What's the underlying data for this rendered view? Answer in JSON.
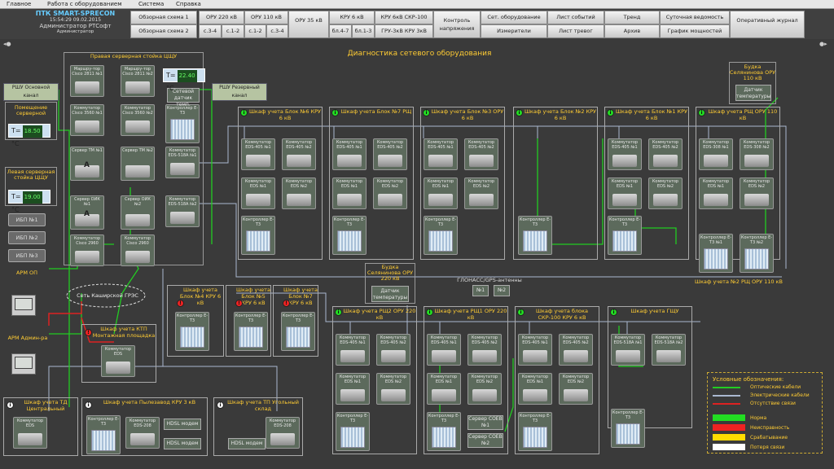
{
  "menu": [
    "Главное",
    "Работа с оборудованием",
    "Система",
    "Справка"
  ],
  "header": {
    "brand": "ПТК SMART-SPRECON",
    "datetime": "15:54:29 09.02.2015",
    "user": "Администратор РТСофт",
    "role": "Администратор"
  },
  "nav": {
    "overview1": "Обзорная схема 1",
    "overview2": "Обзорная схема 2",
    "oru220": "ОРУ 220 кВ",
    "c34a": "с.3-4",
    "c12a": "с.1-2",
    "oru110": "ОРУ 110 кВ",
    "c12b": "с.1-2",
    "c34b": "с.3-4",
    "oru35": "ОРУ 35 кВ",
    "kru6": "КРУ 6 кВ",
    "bl47": "бл.4-7",
    "bl13": "бл.1-3",
    "kru6skr": "КРУ 6кВ СКР-100",
    "gru": "ГРУ-3кВ КРУ 3кВ",
    "control": "Контроль напряжения",
    "net": "Сет. оборудование",
    "meters": "Измерители",
    "events": "Лист событий",
    "alarms": "Лист тревог",
    "trend": "Тренд",
    "archive": "Архив",
    "daily": "Суточная ведомость",
    "power": "График мощностей",
    "journal": "Оперативный журнал"
  },
  "page_title": "Диагностика сетевого оборудования",
  "left": {
    "rack_right": "Правая серверная стойка ЦЩУ",
    "rack_left": "Левая серверная стойка ЦЩУ",
    "room": "Помещение серверной",
    "rsh_main": "РШУ Основной канал",
    "rsh_res": "РШУ Резервный канал",
    "sensor": "Сетевой датчик темп.",
    "t1": "22.40",
    "t2": "18.50",
    "t3": "19.00",
    "deg": "°C",
    "tlabel": "T=",
    "router1": "Маршру-тор Cisco 2811 №1",
    "router2": "Маршру-тор Cisco 2811 №2",
    "sw1": "Коммутатор Cisco 3560 №1",
    "sw2": "Коммутатор Cisco 3560 №2",
    "srv1": "Сервер ТМ №1",
    "srv2": "Сервер ТМ №2",
    "oik1": "Сервер ОИК №1",
    "oik2": "Сервер ОИК №2",
    "c2960a": "Коммутатор Cisco 2960",
    "c2960b": "Коммутатор Cisco 2960",
    "ctl": "Контроллер Е-Т3",
    "eds518a": "Коммутатор EDS-518A №1",
    "eds518b": "Коммутатор EDS-518A №2",
    "ups1": "ИБП №1",
    "ups2": "ИБП №2",
    "ups3": "ИБП №3",
    "arm_op": "АРМ ОП",
    "arm_admin": "АРМ Админ-ра",
    "network": "Сеть Каширской ГРЭС",
    "A": "A"
  },
  "cabinets": [
    {
      "title": "Шкаф учета Блок №6 КРУ 6 кВ"
    },
    {
      "title": "Шкаф учета Блок №7 РЩ"
    },
    {
      "title": "Шкаф учета Блок №3 ОРУ 6 кВ"
    },
    {
      "title": "Шкаф учета Блок №2 КРУ 6 кВ"
    },
    {
      "title": "Шкаф учета Блок №1 КРУ 6 кВ"
    },
    {
      "title": "Шкаф учета РЩ ОРУ 110 кВ"
    }
  ],
  "devices": {
    "eds405_1": "Коммутатор EDS-405 №1",
    "eds405_2": "Коммутатор EDS-405 №2",
    "eds1": "Коммутатор EDS №1",
    "eds2": "Коммутатор EDS №2",
    "ctl": "Контроллер Е-Т3",
    "ctl_short": "Контроллер Е-Т3",
    "c3_1": "Контроллер Е-Т3 №1",
    "c3_2": "Контроллер Е-Т3 №2",
    "eds208": "Коммутатор EDS-208",
    "eds": "Коммутатор EDS",
    "eds518_1": "Коммутатор EDS-518A №1",
    "eds518_2": "Коммутатор EDS-518A №2",
    "eds308_1": "Коммутатор EDS-308 №1",
    "eds308_2": "Коммутатор EDS-308 №2",
    "hdsl": "HDSL модем",
    "ctl_sh": "Контроллер E-T3"
  },
  "right_top": {
    "title": "Будка Селянинова ОРУ 110 кВ",
    "sensor": "Датчик температуры"
  },
  "mid": {
    "bud220": "Будка Селянинова ОРУ 220 кВ",
    "sensor": "Датчик температуры",
    "glonass": "ГЛОНАСС/GPS-антенны",
    "n1": "№1",
    "n2": "№2",
    "rsh2_110": "Шкаф учета №2 РЩ ОРУ 110 кВ"
  },
  "lower_cabs": [
    "Шкаф учета Блок №4 КРУ 6 кВ",
    "Шкаф учета Блок №5 КРУ 6 кВ",
    "Шкаф учета Блок №7 КРУ 6 кВ",
    "Шкаф учета КТП Монтажная площадка",
    "Шкаф учета РЩ2 ОРУ 220 кВ",
    "Шкаф учета РЩ1 ОРУ 220 кВ",
    "Шкаф учета блока СКР-100 КРУ 6 кВ",
    "Шкаф учета ГЩУ",
    "Шкаф учета ТД Центральный",
    "Шкаф учета Пылезавод КРУ 3 кВ",
    "Шкаф учета ТП Угольный склад"
  ],
  "soev1": "Сервер СОЕВ №1",
  "soev2": "Сервер СОЕВ №2",
  "legend": {
    "title": "Условные обозначения:",
    "optical": "Оптические кабели",
    "electric": "Электрические кабели",
    "nolink": "Отсутствие связи",
    "norm": "Норма",
    "fault": "Неисправность",
    "trip": "Срабатывание",
    "lost": "Потеря связи",
    "colors": {
      "norm": "#22dd22",
      "fault": "#ee2222",
      "trip": "#ffdd00",
      "lost": "#ffffff",
      "optical": "#22cc22",
      "electric": "#aab8d0",
      "nolink": "#dd2222"
    }
  },
  "ind_i": "i",
  "ind_ex": "!"
}
